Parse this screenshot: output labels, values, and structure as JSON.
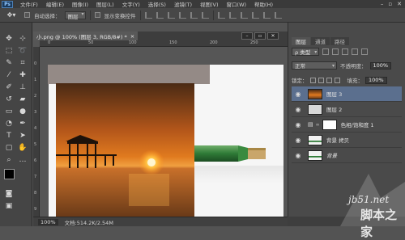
{
  "menubar": {
    "logo": "Ps",
    "items": [
      "文件(F)",
      "编辑(E)",
      "图像(I)",
      "图层(L)",
      "文字(Y)",
      "选择(S)",
      "滤镜(T)",
      "视图(V)",
      "窗口(W)",
      "帮助(H)"
    ]
  },
  "options": {
    "auto_select_label": "自动选择：",
    "auto_select_value": "图层",
    "show_transform_label": "显示变换控件"
  },
  "document": {
    "tab_title": "小.png @ 100% (图层 3, RGB/8#) *",
    "close_glyph": "×"
  },
  "ruler": {
    "top_numbers": [
      "0",
      "50",
      "100",
      "150",
      "200",
      "250"
    ],
    "left_numbers": [
      "0",
      "1",
      "2",
      "3",
      "4",
      "5",
      "6",
      "7",
      "8",
      "9"
    ]
  },
  "status": {
    "zoom": "100%",
    "doc_info": "文档:514.2K/2.54M"
  },
  "panel": {
    "tabs": [
      "图层",
      "通道",
      "路径"
    ],
    "kind_label": "ρ 类型",
    "blend_mode": "正常",
    "opacity_label": "不透明度：",
    "opacity_value": "100%",
    "lock_label": "锁定：",
    "fill_label": "填充：",
    "fill_value": "100%",
    "layers": [
      {
        "name": "图层 3",
        "selected": true
      },
      {
        "name": "图层 2",
        "selected": false
      },
      {
        "name": "色相/饱和度 1",
        "selected": false
      },
      {
        "name": "背景 拷贝",
        "selected": false
      },
      {
        "name": "背景",
        "selected": false
      }
    ]
  },
  "watermark": {
    "line1": "jb51.net",
    "line2": "脚本之家"
  },
  "colors": {
    "selected_layer": "#5b6f8e",
    "bottle_green": "#2e7a36",
    "sunset_orange": "#e07a1f"
  }
}
